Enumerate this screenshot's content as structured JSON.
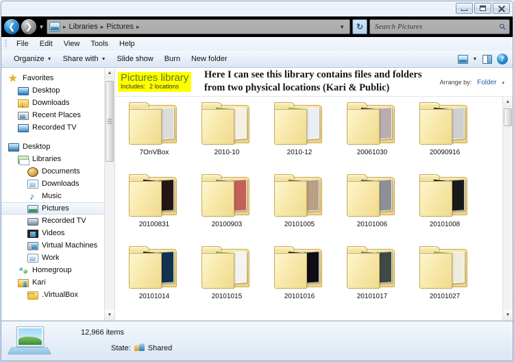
{
  "window": {
    "controls": {
      "minimize": "Minimize",
      "maximize": "Restore",
      "close": "Close"
    }
  },
  "addressbar": {
    "back_tooltip": "Back",
    "forward_tooltip": "Forward",
    "recent_tooltip": "Recent pages",
    "breadcrumbs": [
      "Libraries",
      "Pictures"
    ],
    "separator": "▸",
    "dropdown": "▼",
    "refresh": "↻",
    "folder_icon": "library-icon"
  },
  "search": {
    "placeholder": "Search Pictures",
    "value": "",
    "icon": "search-icon"
  },
  "menubar": {
    "items": [
      "File",
      "Edit",
      "View",
      "Tools",
      "Help"
    ]
  },
  "toolbar": {
    "organize": "Organize",
    "share_with": "Share with",
    "slide_show": "Slide show",
    "burn": "Burn",
    "new_folder": "New folder",
    "caret": "▼",
    "view_icon": "change-view-icon",
    "pane_icon": "preview-pane-icon",
    "help_icon": "help-icon",
    "help_glyph": "?"
  },
  "sidebar": {
    "groups": [
      {
        "label": "Favorites",
        "icon": "star-icon",
        "indent": 0,
        "iconclass": "ico-star",
        "children": [
          {
            "label": "Desktop",
            "icon": "desktop-icon",
            "indent": 1,
            "iconclass": "ico-monitor"
          },
          {
            "label": "Downloads",
            "icon": "downloads-folder-icon",
            "indent": 1,
            "iconclass": "ico-dl"
          },
          {
            "label": "Recent Places",
            "icon": "recent-places-icon",
            "indent": 1,
            "iconclass": "ico-recent"
          },
          {
            "label": "Recorded TV",
            "icon": "recorded-tv-icon",
            "indent": 1,
            "iconclass": "ico-monitor2"
          }
        ]
      },
      {
        "label": "Desktop",
        "icon": "desktop-icon",
        "indent": 0,
        "iconclass": "ico-monitor",
        "children": [
          {
            "label": "Libraries",
            "icon": "libraries-icon",
            "indent": 1,
            "iconclass": "ico-lib"
          },
          {
            "label": "Documents",
            "icon": "documents-library-icon",
            "indent": 2,
            "iconclass": "ico-docs"
          },
          {
            "label": "Downloads",
            "icon": "downloads-library-icon",
            "indent": 2,
            "iconclass": "ico-doc2"
          },
          {
            "label": "Music",
            "icon": "music-library-icon",
            "indent": 2,
            "iconclass": "ico-music"
          },
          {
            "label": "Pictures",
            "icon": "pictures-library-icon",
            "indent": 2,
            "iconclass": "ico-pic",
            "selected": true
          },
          {
            "label": "Recorded TV",
            "icon": "recorded-tv-library-icon",
            "indent": 2,
            "iconclass": "ico-tv"
          },
          {
            "label": "Videos",
            "icon": "videos-library-icon",
            "indent": 2,
            "iconclass": "ico-video"
          },
          {
            "label": "Virtual Machines",
            "icon": "virtual-machines-icon",
            "indent": 2,
            "iconclass": "ico-vm"
          },
          {
            "label": "Work",
            "icon": "work-library-icon",
            "indent": 2,
            "iconclass": "ico-doc2"
          },
          {
            "label": "Homegroup",
            "icon": "homegroup-icon",
            "indent": 1,
            "iconclass": "ico-home"
          },
          {
            "label": "Kari",
            "icon": "user-folder-icon",
            "indent": 1,
            "iconclass": "ico-user"
          },
          {
            "label": ".VirtualBox",
            "icon": "folder-icon",
            "indent": 2,
            "iconclass": "ico-folder"
          }
        ]
      }
    ],
    "scrollbar": {
      "up": "▲",
      "down": "▼"
    }
  },
  "library_header": {
    "title": "Pictures library",
    "includes_label": "Includes:",
    "includes_value": "2 locations",
    "highlight_color": "#ffff00",
    "title_color": "#5a7a1f",
    "arrange_label": "Arrange by:",
    "arrange_value": "Folder",
    "arrange_caret": "▾"
  },
  "annotation": {
    "line1": "Here I can see this library contains files and folders",
    "line2": "from two physical locations (Kari & Public)"
  },
  "content": {
    "scrollbar": {
      "up": "▲",
      "down": "▼"
    },
    "folders": [
      {
        "name": "7OnVBox",
        "thumb_a": "#f2f2f2",
        "thumb_b": "#dcdcdc"
      },
      {
        "name": "2010-10",
        "thumb_a": "#7fa33c",
        "thumb_b": "#f4f0e2"
      },
      {
        "name": "2010-12",
        "thumb_a": "#8fb648",
        "thumb_b": "#e8eef4"
      },
      {
        "name": "20061030",
        "thumb_a": "#3a3a3a",
        "thumb_b": "#b9aeae"
      },
      {
        "name": "20090916",
        "thumb_a": "#2c2420",
        "thumb_b": "#cfcfcf"
      },
      {
        "name": "20100831",
        "thumb_a": "#140d0d",
        "thumb_b": "#241616"
      },
      {
        "name": "20100903",
        "thumb_a": "#9e7e6c",
        "thumb_b": "#c2605a"
      },
      {
        "name": "20101005",
        "thumb_a": "#7e6a53",
        "thumb_b": "#b9a084"
      },
      {
        "name": "20101006",
        "thumb_a": "#54584f",
        "thumb_b": "#8d9197"
      },
      {
        "name": "20101008",
        "thumb_a": "#0c0c0c",
        "thumb_b": "#1a1a1a"
      },
      {
        "name": "20101014",
        "thumb_a": "#1b1b1b",
        "thumb_b": "#12324f"
      },
      {
        "name": "20101015",
        "thumb_a": "#8ab23f",
        "thumb_b": "#f3f3ef"
      },
      {
        "name": "20101016",
        "thumb_a": "#2a1420",
        "thumb_b": "#0e0c14"
      },
      {
        "name": "20101017",
        "thumb_a": "#6b7a62",
        "thumb_b": "#3f4a44"
      },
      {
        "name": "20101027",
        "thumb_a": "#88b240",
        "thumb_b": "#f0ecdc"
      }
    ]
  },
  "details_pane": {
    "icon": "pictures-library-icon",
    "items_count": "12,966 items",
    "state_label": "State:",
    "state_icon": "shared-users-icon",
    "state_value": "Shared"
  }
}
